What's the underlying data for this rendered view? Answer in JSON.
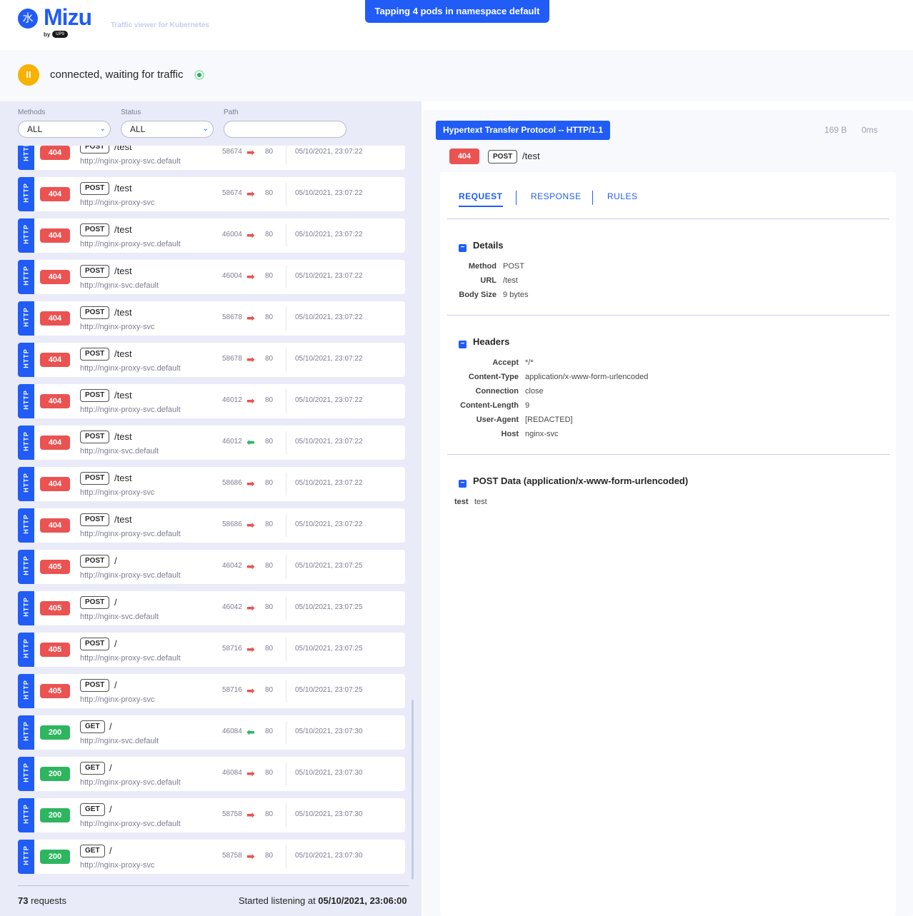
{
  "app": {
    "logo_glyph": "水",
    "name": "Mizu",
    "by": "by",
    "company": "UP9",
    "tagline": "Traffic viewer for Kubernetes",
    "banner": "Tapping 4 pods in namespace default"
  },
  "status": {
    "pause_glyph": "II",
    "text": "connected, waiting for traffic"
  },
  "filters": {
    "methods_label": "Methods",
    "methods_value": "ALL",
    "status_label": "Status",
    "status_value": "ALL",
    "path_label": "Path",
    "path_value": ""
  },
  "entries": [
    {
      "proto": "HTTP",
      "code": "404",
      "method": "POST",
      "path": "/test",
      "service": "http://nginx-proxy-svc.default",
      "src_port": "58674",
      "direction": "out",
      "dst_port": "80",
      "timestamp": "05/10/2021, 23:07:22"
    },
    {
      "proto": "HTTP",
      "code": "404",
      "method": "POST",
      "path": "/test",
      "service": "http://nginx-proxy-svc",
      "src_port": "58674",
      "direction": "out",
      "dst_port": "80",
      "timestamp": "05/10/2021, 23:07:22"
    },
    {
      "proto": "HTTP",
      "code": "404",
      "method": "POST",
      "path": "/test",
      "service": "http://nginx-proxy-svc.default",
      "src_port": "46004",
      "direction": "out",
      "dst_port": "80",
      "timestamp": "05/10/2021, 23:07:22"
    },
    {
      "proto": "HTTP",
      "code": "404",
      "method": "POST",
      "path": "/test",
      "service": "http://nginx-svc.default",
      "src_port": "46004",
      "direction": "out",
      "dst_port": "80",
      "timestamp": "05/10/2021, 23:07:22"
    },
    {
      "proto": "HTTP",
      "code": "404",
      "method": "POST",
      "path": "/test",
      "service": "http://nginx-proxy-svc",
      "src_port": "58678",
      "direction": "out",
      "dst_port": "80",
      "timestamp": "05/10/2021, 23:07:22"
    },
    {
      "proto": "HTTP",
      "code": "404",
      "method": "POST",
      "path": "/test",
      "service": "http://nginx-proxy-svc.default",
      "src_port": "58678",
      "direction": "out",
      "dst_port": "80",
      "timestamp": "05/10/2021, 23:07:22"
    },
    {
      "proto": "HTTP",
      "code": "404",
      "method": "POST",
      "path": "/test",
      "service": "http://nginx-proxy-svc.default",
      "src_port": "46012",
      "direction": "out",
      "dst_port": "80",
      "timestamp": "05/10/2021, 23:07:22"
    },
    {
      "proto": "HTTP",
      "code": "404",
      "method": "POST",
      "path": "/test",
      "service": "http://nginx-svc.default",
      "src_port": "46012",
      "direction": "in",
      "dst_port": "80",
      "timestamp": "05/10/2021, 23:07:22"
    },
    {
      "proto": "HTTP",
      "code": "404",
      "method": "POST",
      "path": "/test",
      "service": "http://nginx-proxy-svc",
      "src_port": "58686",
      "direction": "out",
      "dst_port": "80",
      "timestamp": "05/10/2021, 23:07:22"
    },
    {
      "proto": "HTTP",
      "code": "404",
      "method": "POST",
      "path": "/test",
      "service": "http://nginx-proxy-svc.default",
      "src_port": "58686",
      "direction": "out",
      "dst_port": "80",
      "timestamp": "05/10/2021, 23:07:22"
    },
    {
      "proto": "HTTP",
      "code": "405",
      "method": "POST",
      "path": "/",
      "service": "http://nginx-proxy-svc.default",
      "src_port": "46042",
      "direction": "out",
      "dst_port": "80",
      "timestamp": "05/10/2021, 23:07:25"
    },
    {
      "proto": "HTTP",
      "code": "405",
      "method": "POST",
      "path": "/",
      "service": "http://nginx-svc.default",
      "src_port": "46042",
      "direction": "out",
      "dst_port": "80",
      "timestamp": "05/10/2021, 23:07:25"
    },
    {
      "proto": "HTTP",
      "code": "405",
      "method": "POST",
      "path": "/",
      "service": "http://nginx-proxy-svc.default",
      "src_port": "58716",
      "direction": "out",
      "dst_port": "80",
      "timestamp": "05/10/2021, 23:07:25"
    },
    {
      "proto": "HTTP",
      "code": "405",
      "method": "POST",
      "path": "/",
      "service": "http://nginx-proxy-svc",
      "src_port": "58716",
      "direction": "out",
      "dst_port": "80",
      "timestamp": "05/10/2021, 23:07:25"
    },
    {
      "proto": "HTTP",
      "code": "200",
      "method": "GET",
      "path": "/",
      "service": "http://nginx-svc.default",
      "src_port": "46084",
      "direction": "in",
      "dst_port": "80",
      "timestamp": "05/10/2021, 23:07:30"
    },
    {
      "proto": "HTTP",
      "code": "200",
      "method": "GET",
      "path": "/",
      "service": "http://nginx-proxy-svc.default",
      "src_port": "46084",
      "direction": "out",
      "dst_port": "80",
      "timestamp": "05/10/2021, 23:07:30"
    },
    {
      "proto": "HTTP",
      "code": "200",
      "method": "GET",
      "path": "/",
      "service": "http://nginx-proxy-svc.default",
      "src_port": "58758",
      "direction": "out",
      "dst_port": "80",
      "timestamp": "05/10/2021, 23:07:30"
    },
    {
      "proto": "HTTP",
      "code": "200",
      "method": "GET",
      "path": "/",
      "service": "http://nginx-proxy-svc",
      "src_port": "58758",
      "direction": "out",
      "dst_port": "80",
      "timestamp": "05/10/2021, 23:07:30"
    }
  ],
  "footer": {
    "count": "73",
    "count_suffix": " requests",
    "started_prefix": "Started listening at ",
    "started_at": "05/10/2021, 23:06:00"
  },
  "detail": {
    "protocol": "Hypertext Transfer Protocol -- HTTP/1.1",
    "size": "169 B",
    "duration": "0ms",
    "code": "404",
    "method": "POST",
    "path": "/test",
    "tabs": [
      "REQUEST",
      "RESPONSE",
      "RULES"
    ],
    "collapse_glyph": "−",
    "details_title": "Details",
    "details": [
      {
        "k": "Method",
        "v": "POST"
      },
      {
        "k": "URL",
        "v": "/test"
      },
      {
        "k": "Body Size",
        "v": "9 bytes"
      }
    ],
    "headers_title": "Headers",
    "headers": [
      {
        "k": "Accept",
        "v": "*/*"
      },
      {
        "k": "Content-Type",
        "v": "application/x-www-form-urlencoded"
      },
      {
        "k": "Connection",
        "v": "close"
      },
      {
        "k": "Content-Length",
        "v": "9"
      },
      {
        "k": "User-Agent",
        "v": "[REDACTED]"
      },
      {
        "k": "Host",
        "v": "nginx-svc"
      }
    ],
    "post_title": "POST Data (application/x-www-form-urlencoded)",
    "post": [
      {
        "k": "test",
        "v": "test"
      }
    ]
  },
  "colors": {
    "accent": "#205cf5",
    "error": "#eb5252",
    "success": "#2eb560",
    "paused": "#f7b202"
  },
  "icons": {
    "direction_out": "arrow-right-icon",
    "direction_in": "arrow-left-icon",
    "select": "chevron-down-icon"
  }
}
